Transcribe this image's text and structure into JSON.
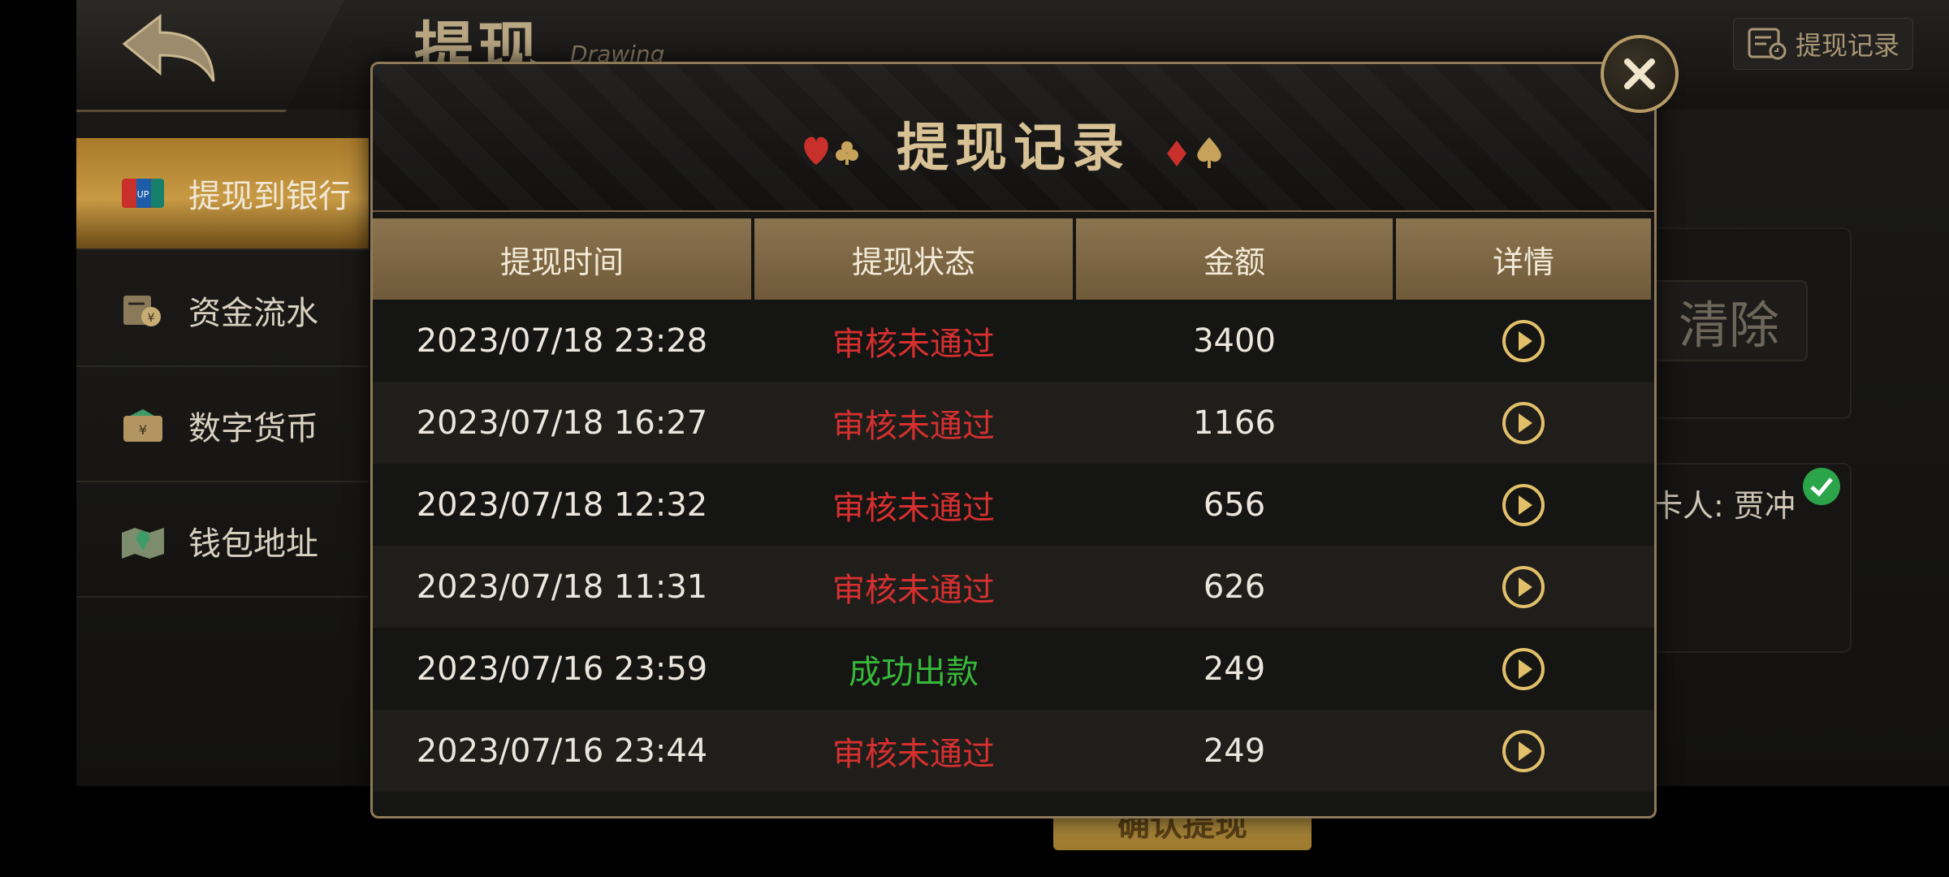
{
  "header": {
    "title": "提现",
    "subtitle": "Drawing",
    "record_button_label": "提现记录"
  },
  "sidebar": {
    "items": [
      {
        "label": "提现到银行",
        "icon": "unionpay-card-icon",
        "active": true
      },
      {
        "label": "资金流水",
        "icon": "fund-flow-icon",
        "active": false
      },
      {
        "label": "数字货币",
        "icon": "wallet-icon",
        "active": false
      },
      {
        "label": "钱包地址",
        "icon": "map-pin-icon",
        "active": false
      }
    ]
  },
  "background_form": {
    "clear_label": "清除",
    "card_holder": "卡人: 贾冲",
    "apply_label": "确认提现"
  },
  "modal": {
    "title": "提现记录",
    "columns": [
      "提现时间",
      "提现状态",
      "金额",
      "详情"
    ],
    "rows": [
      {
        "time": "2023/07/18 23:28",
        "status": "审核未通过",
        "status_type": "fail",
        "amount": "3400"
      },
      {
        "time": "2023/07/18 16:27",
        "status": "审核未通过",
        "status_type": "fail",
        "amount": "1166"
      },
      {
        "time": "2023/07/18 12:32",
        "status": "审核未通过",
        "status_type": "fail",
        "amount": "656"
      },
      {
        "time": "2023/07/18 11:31",
        "status": "审核未通过",
        "status_type": "fail",
        "amount": "626"
      },
      {
        "time": "2023/07/16 23:59",
        "status": "成功出款",
        "status_type": "ok",
        "amount": "249"
      },
      {
        "time": "2023/07/16 23:44",
        "status": "审核未通过",
        "status_type": "fail",
        "amount": "249"
      }
    ]
  },
  "colors": {
    "fail": "#d6302f",
    "ok": "#36b93a",
    "gold": "#d8c194",
    "accent_border": "#8e7a57"
  }
}
